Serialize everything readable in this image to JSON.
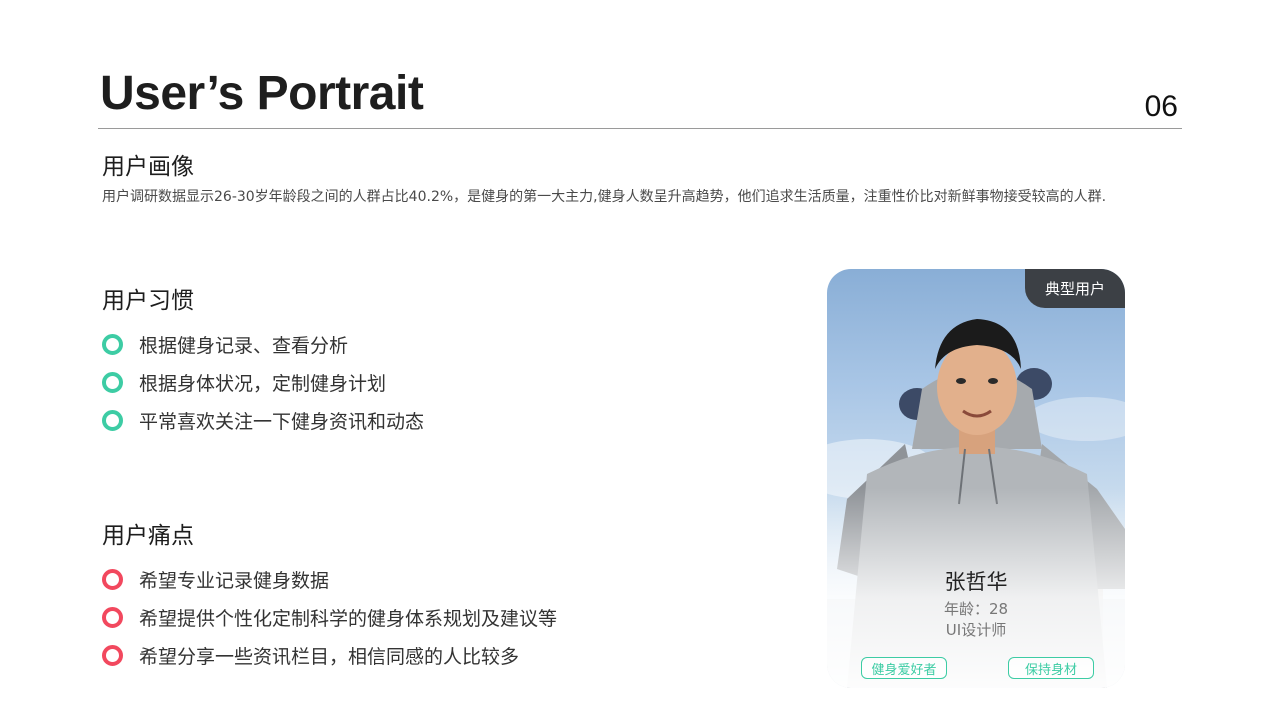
{
  "header": {
    "title": "User’s Portrait",
    "page_number": "06"
  },
  "portrait": {
    "heading": "用户画像",
    "description": "用户调研数据显示26-30岁年龄段之间的人群占比40.2%，是健身的第一大主力,健身人数呈升高趋势，他们追求生活质量，注重性价比对新鲜事物接受较高的人群."
  },
  "habits": {
    "heading": "用户习惯",
    "items": [
      "根据健身记录、查看分析",
      "根据身体状况，定制健身计划",
      "平常喜欢关注一下健身资讯和动态"
    ],
    "bullet_color": "#3dcca4"
  },
  "pain_points": {
    "heading": "用户痛点",
    "items": [
      "希望专业记录健身数据",
      "希望提供个性化定制科学的健身体系规划及建议等",
      "希望分享一些资讯栏目，相信同感的人比较多"
    ],
    "bullet_color": "#f2485e"
  },
  "profile_card": {
    "tag": "典型用户",
    "name": "张哲华",
    "age": "年龄：28",
    "job": "UI设计师",
    "tags": [
      "健身爱好者",
      "保持身材"
    ]
  }
}
